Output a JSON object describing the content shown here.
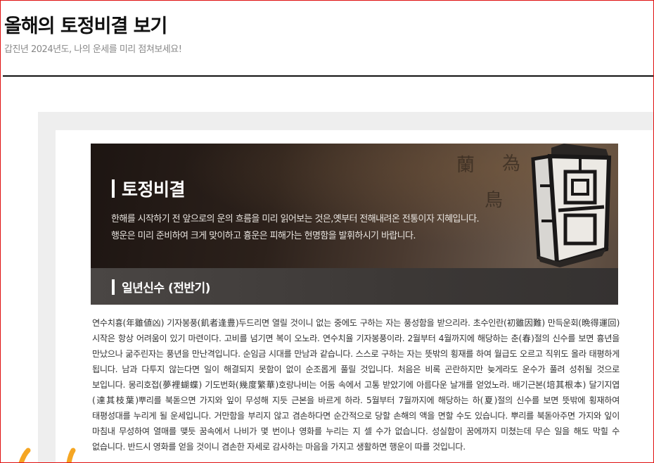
{
  "page": {
    "title": "올해의 토정비결 보기",
    "subtitle": "갑진년 2024년도, 나의 운세를 미리 점쳐보세요!"
  },
  "banner": {
    "title": "토정비결",
    "desc_line1": "한해를 시작하기 전 앞으로의 운의 흐름을 미리 읽어보는 것은,옛부터 전해내려온 전통이자 지혜입니다.",
    "desc_line2": "행운은 미리 준비하여 크게 맞이하고 흉운은 피해가는 현명함을 발휘하시기 바랍니다."
  },
  "section": {
    "title": "일년신수 (전반기)"
  },
  "content": {
    "text": "연수치흉(年雖値凶) 기자봉풍(飢者逢豊)두드리면 열릴 것이니 없는 중에도 구하는 자는 풍성함을 받으리라. 초수인란(初雖因難) 만득운회(晩得運回)시작은 항상 어려움이 있기 마련이다. 고비를 넘기면 복이 오노라. 연수치율 기자봉풍이라. 2월부터 4월까지에 해당하는 춘(春)절의 신수를 보면 흉년을 만났으나 굶주린자는 풍년을 만난격입니다. 순임금 시대를 만남과 같습니다. 스스로 구하는 자는 뜻밖의 횡재를 하여 월급도 오르고 직위도 올라 태평하게 됩니다. 남과 다투지 않는다면 일이 해결되지 못함이 없이 순조롭게 풀릴 것입니다. 처음은 비록 곤란하지만 늦게라도 운수가 풀려 성취될 것으로 보입니다. 몽리호접(夢裡蝴蝶) 기도번화(幾度繁華)호랑나비는 어둠 속에서 고통 받았기에 아름다운 날개를 얻었노라. 배기근본(培其根本) 달기지엽(達其枝葉)뿌리를 북돋으면 가지와 잎이 무성해 지듯 근본을 바르게 하라. 5월부터 7월까지에 해당하는 하(夏)절의 신수를 보면 뜻밖에 횡재하여 태평성대를 누리게 될 운세입니다. 거만함을 부리지 않고 겸손하다면 순간적으로 당할 손해의 액을 면할 수도 있습니다. 뿌리를 북돋아주면 가지와 잎이 마침내 무성하여 열매를 맺듯 꿈속에서 나비가 몇 번이나 영화를 누리는 지 셀 수가 없습니다. 성실함이 꿈에까지 미쳤는데 무슨 일을 해도 막힐 수 없습니다. 반드시 영화를 얻을 것이니 겸손한 자세로 감사하는 마음을 가지고 생활하면 행운이 따를 것입니다."
  },
  "colors": {
    "frame_border": "#e01010",
    "banner_dark": "#2c211b",
    "section_bar": "#3c3836",
    "deco_orange": "#f5a623"
  },
  "icons": {
    "lantern": "lantern-icon"
  }
}
